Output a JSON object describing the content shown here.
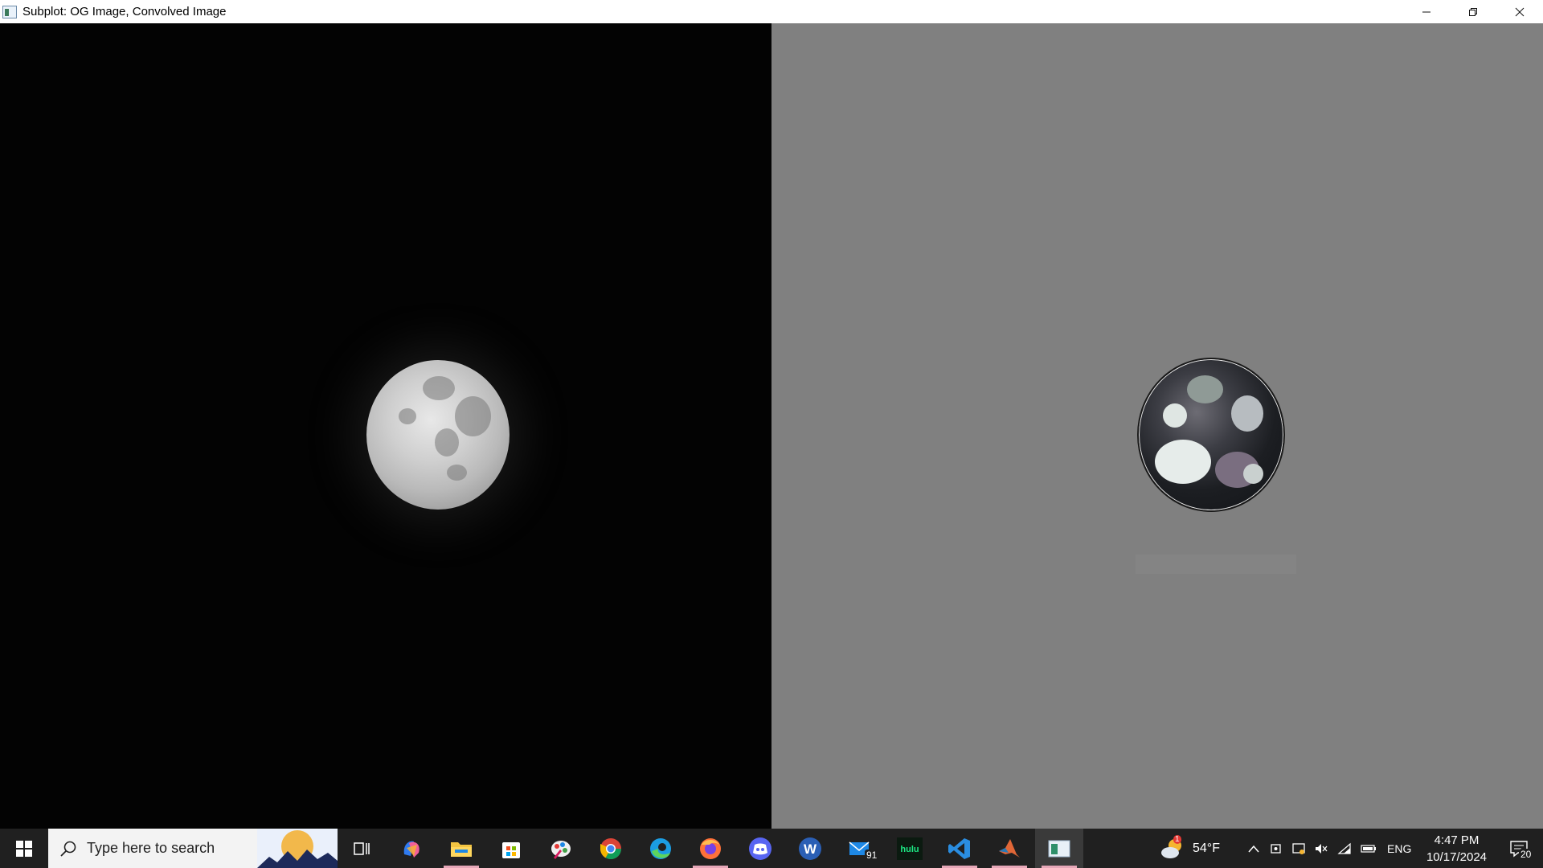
{
  "window": {
    "title": "Subplot: OG Image, Convolved Image",
    "minimize_label": "Minimize",
    "restore_label": "Restore",
    "close_label": "Close"
  },
  "left_image": {
    "label": "OG Image",
    "background": "#030303"
  },
  "right_image": {
    "label": "Convolved Image",
    "background": "#808080"
  },
  "taskbar": {
    "search_placeholder": "Type here to search",
    "weather_temp": "54°F",
    "weather_alert_count": "1",
    "mail_badge": "91",
    "language": "ENG",
    "time": "4:47 PM",
    "date": "10/17/2024",
    "notification_count": "20",
    "icons": [
      "windows-start-icon",
      "search-icon",
      "task-view-icon",
      "copilot-icon",
      "file-explorer-icon",
      "microsoft-store-icon",
      "paint-icon",
      "chrome-icon",
      "edge-icon",
      "firefox-icon",
      "discord-icon",
      "word-icon",
      "mail-icon",
      "hulu-icon",
      "vscode-icon",
      "matlab-icon",
      "active-window-icon"
    ]
  },
  "colors": {
    "taskbar_bg": "#202020",
    "active_underline": "#e6a7b8"
  }
}
